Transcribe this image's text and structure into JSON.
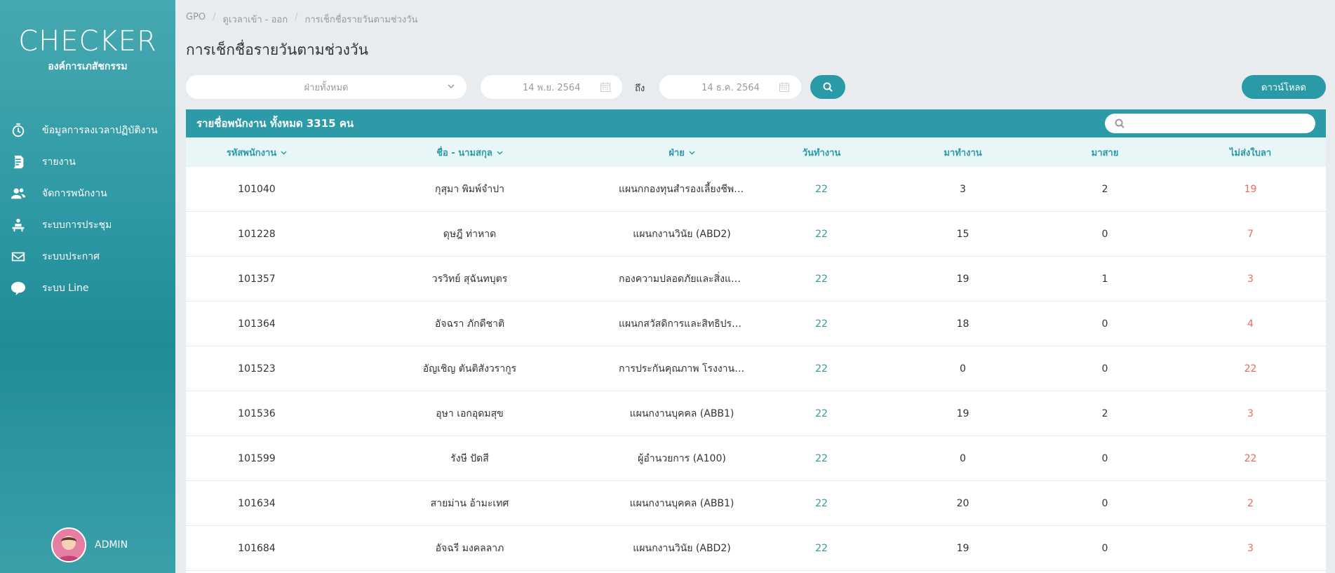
{
  "sidebar": {
    "logo_text": "CHECKER",
    "org_name": "องค์การเภสัชกรรม",
    "items": [
      {
        "label": "ข้อมูลการลงเวลาปฏิบัติงาน",
        "icon": "stopwatch-icon"
      },
      {
        "label": "รายงาน",
        "icon": "report-icon"
      },
      {
        "label": "จัดการพนักงาน",
        "icon": "users-icon"
      },
      {
        "label": "ระบบการประชุม",
        "icon": "meeting-icon"
      },
      {
        "label": "ระบบประกาศ",
        "icon": "envelope-icon"
      },
      {
        "label": "ระบบ Line",
        "icon": "line-icon"
      }
    ],
    "user": {
      "name": "ADMIN"
    }
  },
  "breadcrumb": [
    "GPO",
    "ดูเวลาเข้า - ออก",
    "การเช็กชื่อรายวันตามช่วงวัน"
  ],
  "page_title": "การเช็กชื่อรายวันตามช่วงวัน",
  "filters": {
    "department": "ฝ่ายทั้งหมด",
    "date_from": "14 พ.ย. 2564",
    "to_label": "ถึง",
    "date_to": "14 ธ.ค. 2564",
    "download_label": "ดาวน์โหลด"
  },
  "table": {
    "title": "รายชื่อพนักงาน ทั้งหมด 3315 คน",
    "search_placeholder": "",
    "columns": [
      "รหัสพนักงาน",
      "ชื่อ - นามสกุล",
      "ฝ่าย",
      "วันทำงาน",
      "มาทำงาน",
      "มาสาย",
      "ไม่ส่งใบลา"
    ],
    "rows": [
      {
        "id": "101040",
        "name": "กุสุมา พิมพ์จำปา",
        "dept": "แผนกกองทุนสำรองเลี้ยงชีพ (AB...",
        "workdays": "22",
        "present": "3",
        "late": "2",
        "no_leave": "19"
      },
      {
        "id": "101228",
        "name": "ดุษฎี ท่าหาด",
        "dept": "แผนกงานวินัย (ABD2)",
        "workdays": "22",
        "present": "15",
        "late": "0",
        "no_leave": "7"
      },
      {
        "id": "101357",
        "name": "วรวิทย์ สุฉันทบุตร",
        "dept": "กองความปลอดภัยและสิ่งแวดล้อ...",
        "workdays": "22",
        "present": "19",
        "late": "1",
        "no_leave": "3"
      },
      {
        "id": "101364",
        "name": "อัจฉรา ภักดีชาติ",
        "dept": "แผนกสวัสดิการและสิทธิประโยชน์...",
        "workdays": "22",
        "present": "18",
        "late": "0",
        "no_leave": "4"
      },
      {
        "id": "101523",
        "name": "อัญเชิญ ตันติสังวรากูร",
        "dept": "การประกันคุณภาพ โรงงานผลิตย...",
        "workdays": "22",
        "present": "0",
        "late": "0",
        "no_leave": "22"
      },
      {
        "id": "101536",
        "name": "อุษา เอกอุดมสุข",
        "dept": "แผนกงานบุคคล (ABB1)",
        "workdays": "22",
        "present": "19",
        "late": "2",
        "no_leave": "3"
      },
      {
        "id": "101599",
        "name": "รังษี ปัดสี",
        "dept": "ผู้อำนวยการ (A100)",
        "workdays": "22",
        "present": "0",
        "late": "0",
        "no_leave": "22"
      },
      {
        "id": "101634",
        "name": "สายม่าน อ้ามะเทศ",
        "dept": "แผนกงานบุคคล (ABB1)",
        "workdays": "22",
        "present": "20",
        "late": "0",
        "no_leave": "2"
      },
      {
        "id": "101684",
        "name": "อัจฉรี มงคลลาภ",
        "dept": "แผนกงานวินัย (ABD2)",
        "workdays": "22",
        "present": "19",
        "late": "0",
        "no_leave": "3"
      }
    ]
  },
  "colors": {
    "accent": "#2a9aa6",
    "warning": "#f0665a",
    "header_bg": "#e8f6f8"
  }
}
